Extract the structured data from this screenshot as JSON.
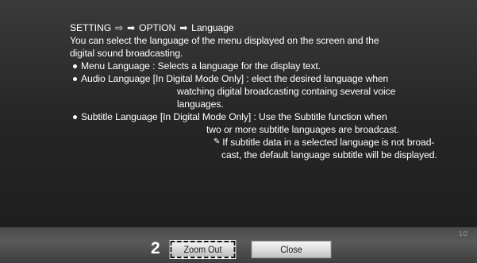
{
  "breadcrumb": {
    "setting": "SETTING",
    "sep1": "⇨",
    "sep2": "➡",
    "option": "OPTION",
    "sep3": "➡",
    "language": "Language"
  },
  "intro": {
    "line1": "You can select the language of the menu displayed on the screen and the",
    "line2": "digital sound broadcasting."
  },
  "items": {
    "menu": {
      "line1": "Menu Language : Selects a language for the display text."
    },
    "audio": {
      "line1": "Audio Language  [In Digital Mode Only] : elect the desired language when",
      "line2": "watching digital broadcasting containg several voice",
      "line3": "languages."
    },
    "subtitle": {
      "line1": "Subtitle Language [In Digital Mode Only] : Use the Subtitle function when",
      "line2": "two or more subtitle languages are broadcast.",
      "note_icon": "✎",
      "note_line1": "If subtitle data in a selected language is not broad-",
      "note_line2": "cast, the default language subtitle will be displayed."
    }
  },
  "footer": {
    "step_number": "2",
    "zoom_out_label": "Zoom Out",
    "close_label": "Close",
    "page_indicator": "1/2"
  }
}
